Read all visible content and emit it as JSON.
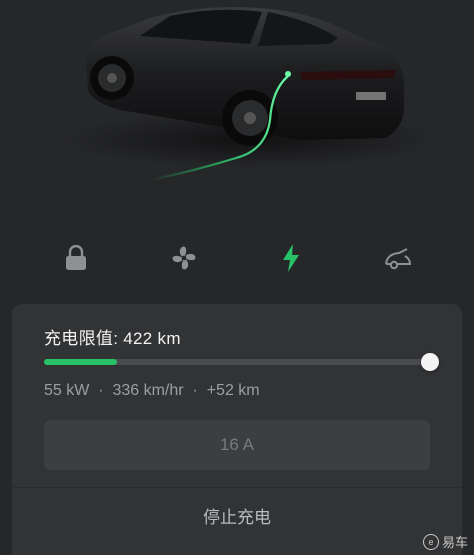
{
  "charge_limit": {
    "label": "充电限值:",
    "value": "422 km",
    "fraction": 0.19
  },
  "stats": {
    "power": "55 kW",
    "rate": "336 km/hr",
    "added": "+52 km",
    "separator": "·"
  },
  "amperage": {
    "value": "16 A"
  },
  "stop_button": {
    "label": "停止充电"
  },
  "quick_controls": [
    {
      "icon": "lock-icon",
      "active": false
    },
    {
      "icon": "fan-icon",
      "active": false
    },
    {
      "icon": "lightning-icon",
      "active": true
    },
    {
      "icon": "charge-port-icon",
      "active": false
    }
  ],
  "watermark": {
    "text": "易车",
    "glyph": "e"
  },
  "colors": {
    "accent": "#27c268",
    "background": "#262729",
    "panel": "#323335"
  }
}
